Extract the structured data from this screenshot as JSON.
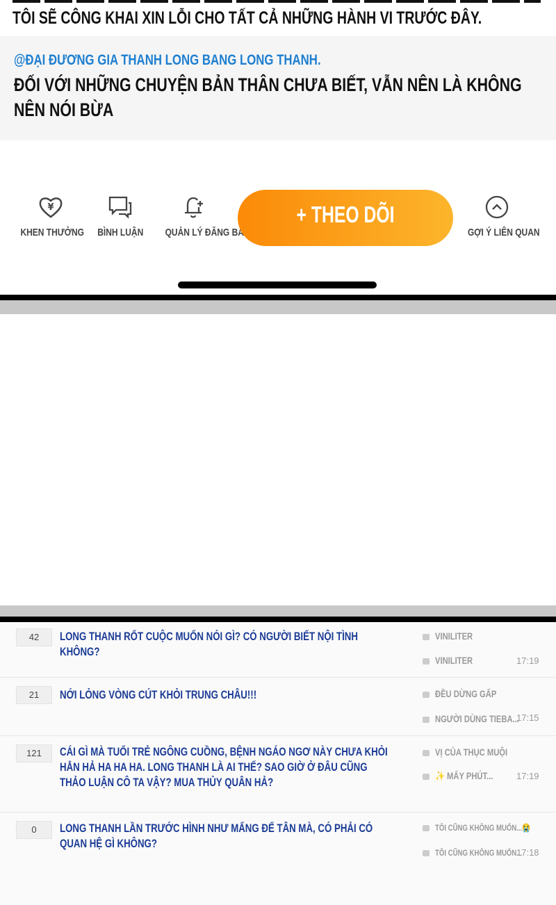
{
  "post": {
    "line1": "TÔI SẼ CÔNG KHAI XIN LỖI CHO TẤT CẢ NHỮNG HÀNH VI TRƯỚC ĐÂY.",
    "mention": "@ĐẠI ĐƯƠNG GIA THANH LONG BANG LONG THANH.",
    "reply": "ĐỐI VỚI NHỮNG CHUYỆN BẢN THÂN CHƯA BIẾT, VẪN NÊN LÀ KHÔNG NÊN NÓI BỪA"
  },
  "actions": [
    {
      "label": "KHEN THƯỞNG",
      "icon": "heart-yen-icon"
    },
    {
      "label": "BÌNH LUẬN",
      "icon": "comment-icon"
    },
    {
      "label": "QUẢN LÝ ĐĂNG BÀI",
      "icon": "bell-plus-icon"
    },
    {
      "label": "GỢI Ý LIÊN QUAN",
      "icon": "chevron-up-circle-icon"
    }
  ],
  "follow_label": "+ THEO DÕI",
  "accent": "#fb8a08",
  "threads": [
    {
      "count": "42",
      "title": "LONG THANH RỐT CUỘC MUỐN NÓI GÌ? CÓ NGƯỜI BIẾT NỘI TÌNH KHÔNG?",
      "author": "VINILITER",
      "last": "VINILITER",
      "time": "17:19"
    },
    {
      "count": "21",
      "title": "NỚI LỎNG VÒNG CÚT KHỎI TRUNG CHÂU!!!",
      "author": "ĐỀU DỪNG GẤP",
      "last": "NGƯỜI DÙNG TIEBA...",
      "time": "17:15"
    },
    {
      "count": "121",
      "title": "CÁI GÌ MÀ TUỔI TRẺ NGÔNG CUỒNG, BỆNH NGÁO NGƠ NÀY CHƯA KHỎI HẲN HẢ HA HA HA. LONG THANH LÀ AI THẾ? SAO GIỜ Ở ĐÂU CŨNG THẢO LUẬN CÔ TA VẬY? MUA THỦY QUÂN HẢ?",
      "author": "VỊ CỦA THỤC MUỘI",
      "last": "✨ MẤY PHÚT...",
      "time": "17:19"
    },
    {
      "count": "0",
      "title": "LONG THANH LẦN TRƯỚC HÌNH NHƯ MẤNG ĐẾ TÂN MÀ, CÓ PHẢI CÓ QUAN HỆ GÌ KHÔNG?",
      "author": "TÔI CŨNG KHÔNG MUỐN...😭",
      "last": "TÔI CŨNG KHÔNG MUỐN...",
      "time": "17:18"
    }
  ]
}
